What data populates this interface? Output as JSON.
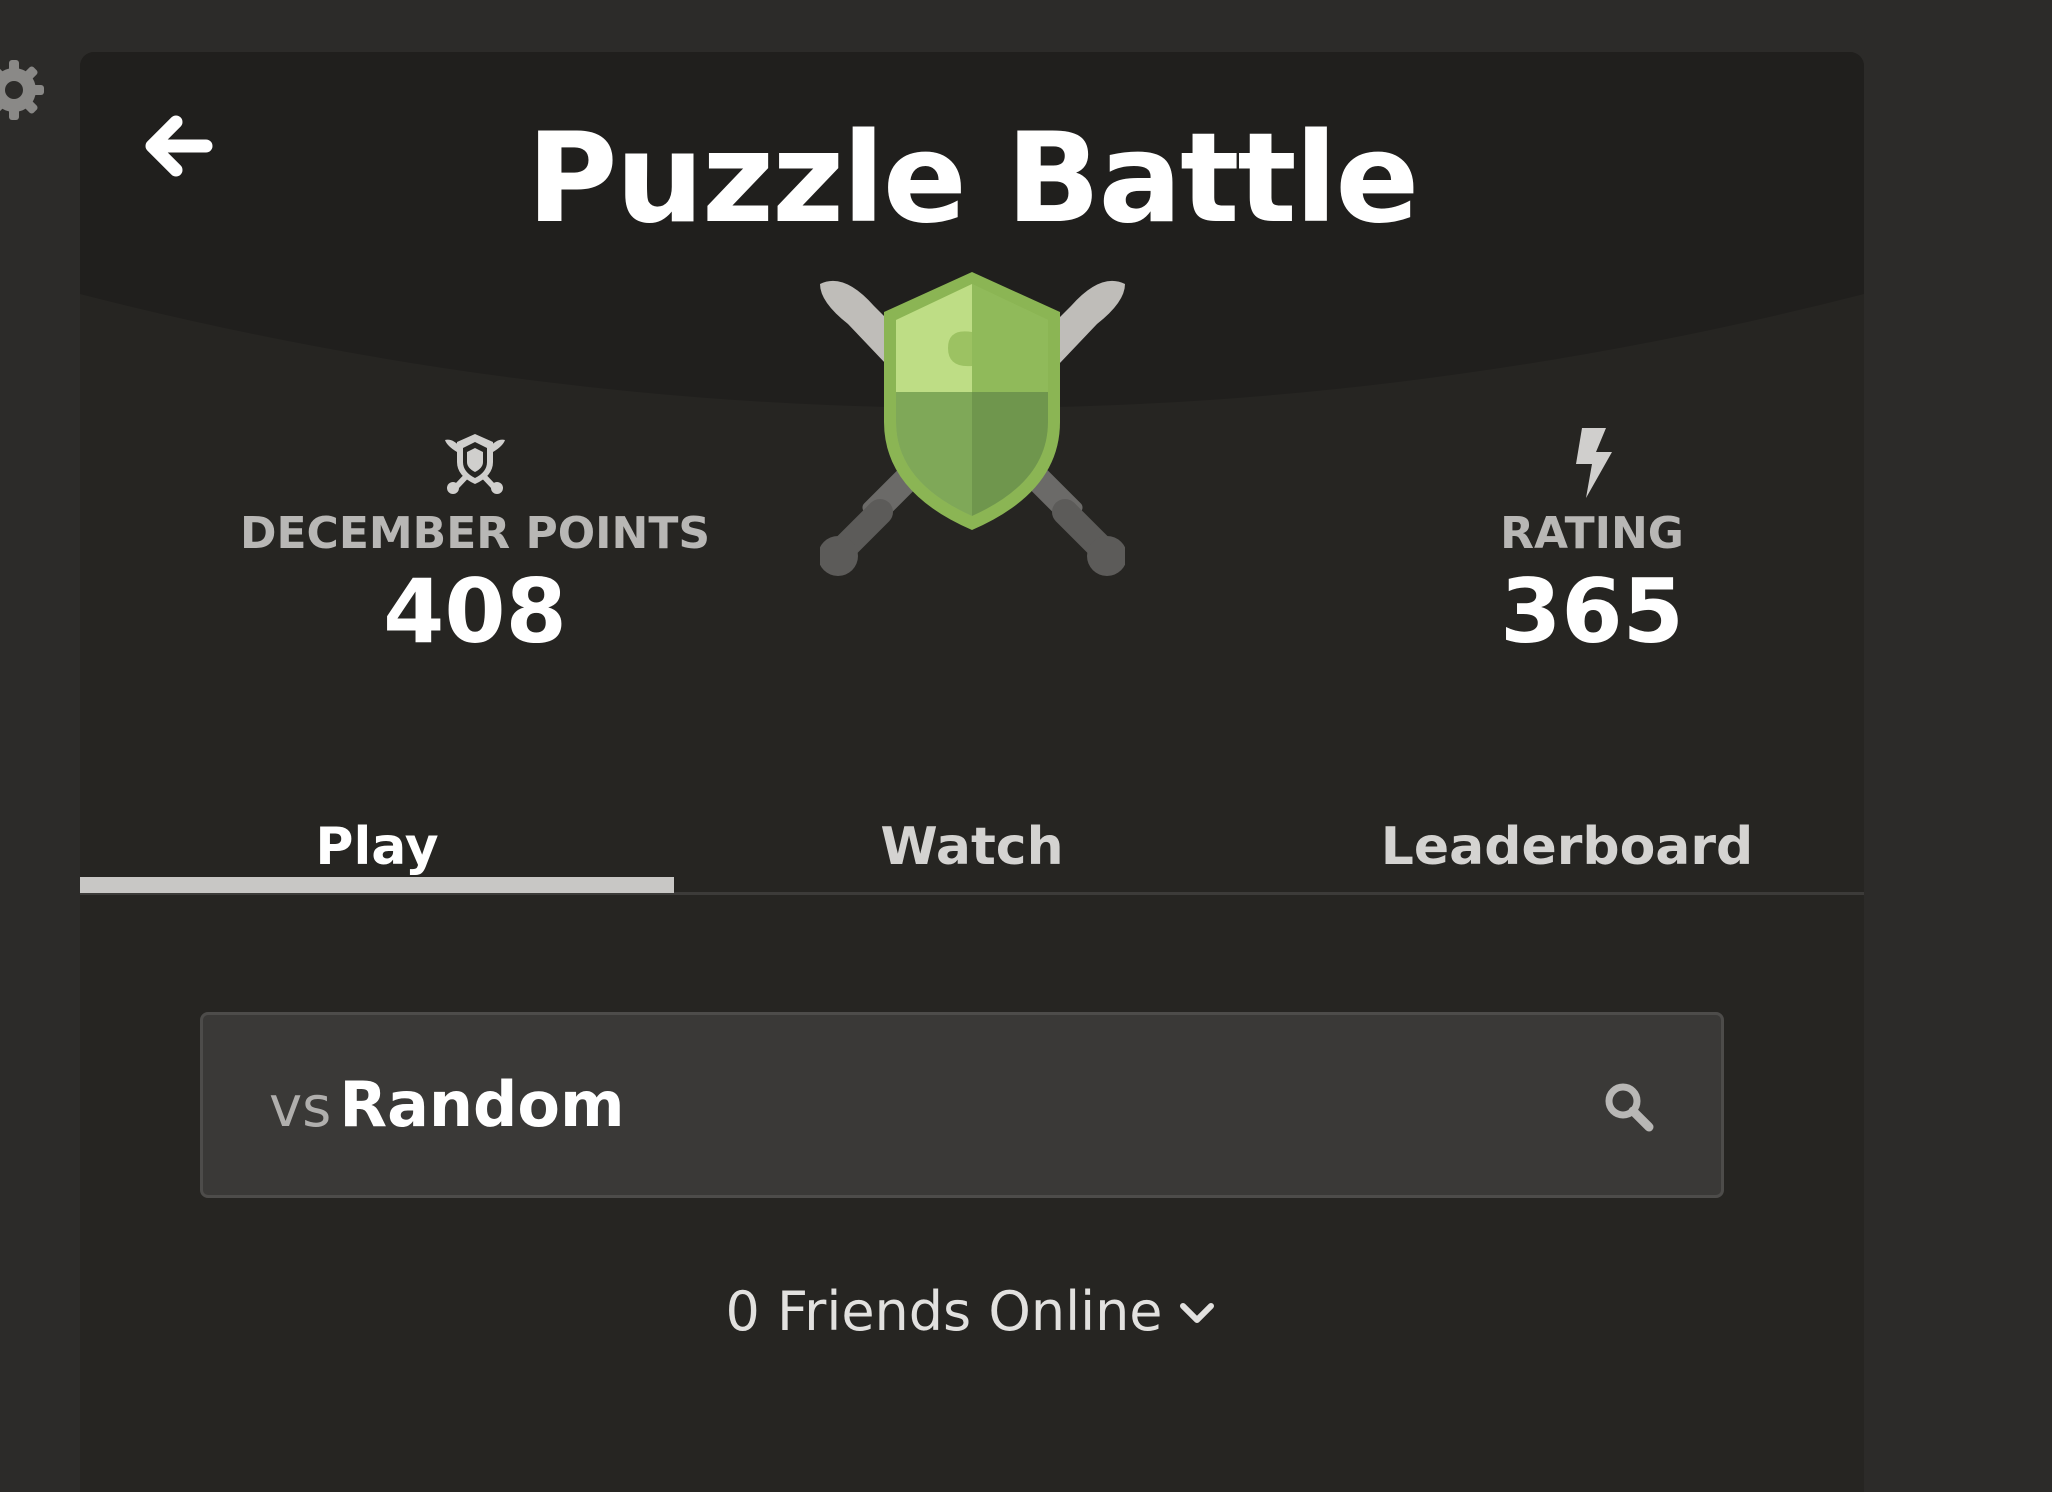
{
  "header": {
    "title": "Puzzle Battle",
    "back_icon": "back-arrow-icon",
    "settings_icon": "gear-icon"
  },
  "stats": {
    "points": {
      "label": "DECEMBER POINTS",
      "value": "408",
      "icon": "shield-swords-icon"
    },
    "rating": {
      "label": "RATING",
      "value": "365",
      "icon": "lightning-bolt-icon"
    }
  },
  "tabs": [
    {
      "label": "Play",
      "active": true
    },
    {
      "label": "Watch",
      "active": false
    },
    {
      "label": "Leaderboard",
      "active": false
    }
  ],
  "opponent_search": {
    "prefix": "vs",
    "value": "Random",
    "icon": "search-icon"
  },
  "friends": {
    "text": "0 Friends Online",
    "icon": "chevron-down-icon"
  },
  "colors": {
    "page_bg": "#2c2b29",
    "panel_bg": "#262522",
    "header_curve": "#201f1d",
    "shield_green": "#8bb554",
    "shield_light": "#bedd85",
    "shield_dark": "#6f964d",
    "sword_gray": "#5c5b59"
  }
}
